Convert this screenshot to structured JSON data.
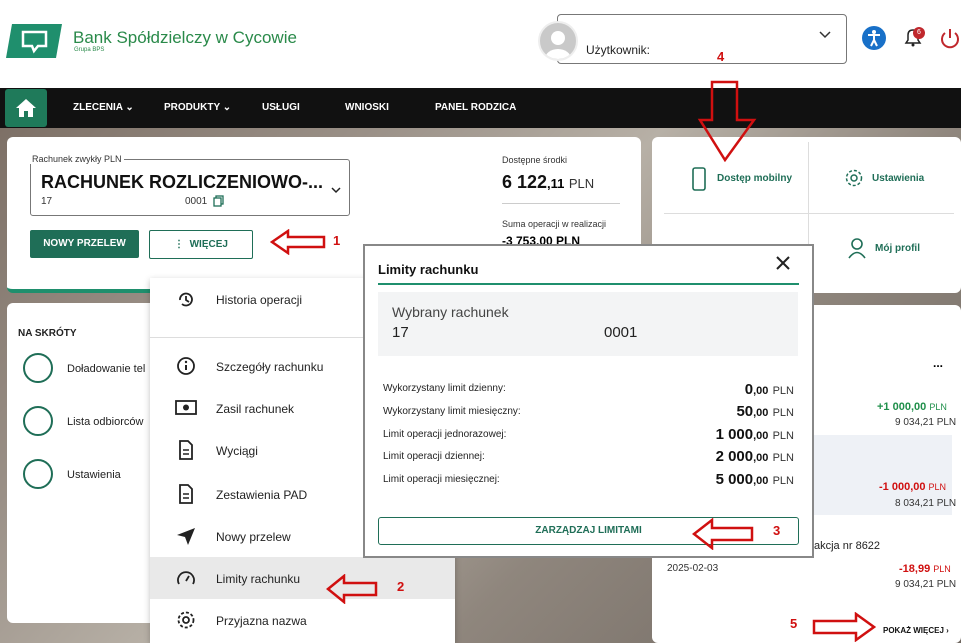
{
  "header": {
    "bank_name": "Bank Spółdzielczy w Cycowie",
    "bank_sub": "Grupa BPS",
    "user_label": "Użytkownik: ",
    "notification_count": "6"
  },
  "nav": {
    "items": [
      "ZLECENIA",
      "PRODUKTY",
      "USŁUGI",
      "WNIOSKI",
      "PANEL RODZICA"
    ]
  },
  "account": {
    "type_label": "Rachunek zwykły PLN",
    "name": "RACHUNEK ROZLICZENIOWO-...",
    "num_start": "17",
    "num_end": "0001",
    "new_transfer": "NOWY PRZELEW",
    "more": "WIĘCEJ",
    "available_label": "Dostępne środki",
    "available_int": "6 122",
    "available_dec": ",11",
    "currency": "PLN",
    "pending_label": "Suma operacji w realizacji",
    "pending_amount": "-3 753,00 PLN"
  },
  "quick": {
    "mobile": "Dostęp mobilny",
    "settings": "Ustawienia",
    "profile": "Mój profil"
  },
  "shortcuts": {
    "title": "NA SKRÓTY",
    "items": [
      "Doładowanie tel",
      "Lista odbiorców",
      "Ustawienia"
    ]
  },
  "dropdown": {
    "items": [
      "Historia operacji",
      "Szczegóły rachunku",
      "Zasil rachunek",
      "Wyciągi",
      "Zestawienia PAD",
      "Nowy przelew",
      "Limity rachunku",
      "Przyjazna nazwa"
    ]
  },
  "transactions": {
    "dots": "...",
    "t1_amount": "+1 000,00",
    "t1_balance": "9 034,21 PLN",
    "t2_amount": "-1 000,00",
    "t2_balance": "8 034,21 PLN",
    "t3_desc": "akcja nr 8622",
    "t3_date": "2025-02-03",
    "t3_amount": "-18,99",
    "t3_balance": "9 034,21 PLN",
    "currency": "PLN",
    "show_more": "POKAŻ WIĘCEJ"
  },
  "modal": {
    "title": "Limity rachunku",
    "selected_label": "Wybrany rachunek",
    "acct_start": "17",
    "acct_end": "0001",
    "rows": [
      {
        "label": "Wykorzystany limit dzienny:",
        "int": "0",
        "dec": ",00"
      },
      {
        "label": "Wykorzystany limit miesięczny:",
        "int": "50",
        "dec": ",00"
      },
      {
        "label": "Limit operacji jednorazowej:",
        "int": "1 000",
        "dec": ",00"
      },
      {
        "label": "Limit operacji dziennej:",
        "int": "2 000",
        "dec": ",00"
      },
      {
        "label": "Limit operacji miesięcznej:",
        "int": "5 000",
        "dec": ",00"
      }
    ],
    "currency": "PLN",
    "manage_button": "ZARZĄDZAJ LIMITAMI"
  },
  "annotations": [
    "1",
    "2",
    "3",
    "4",
    "5"
  ],
  "colors": {
    "brand_green": "#1f6e57",
    "accent": "#1f8f6d",
    "arrow_red": "#d01010"
  }
}
